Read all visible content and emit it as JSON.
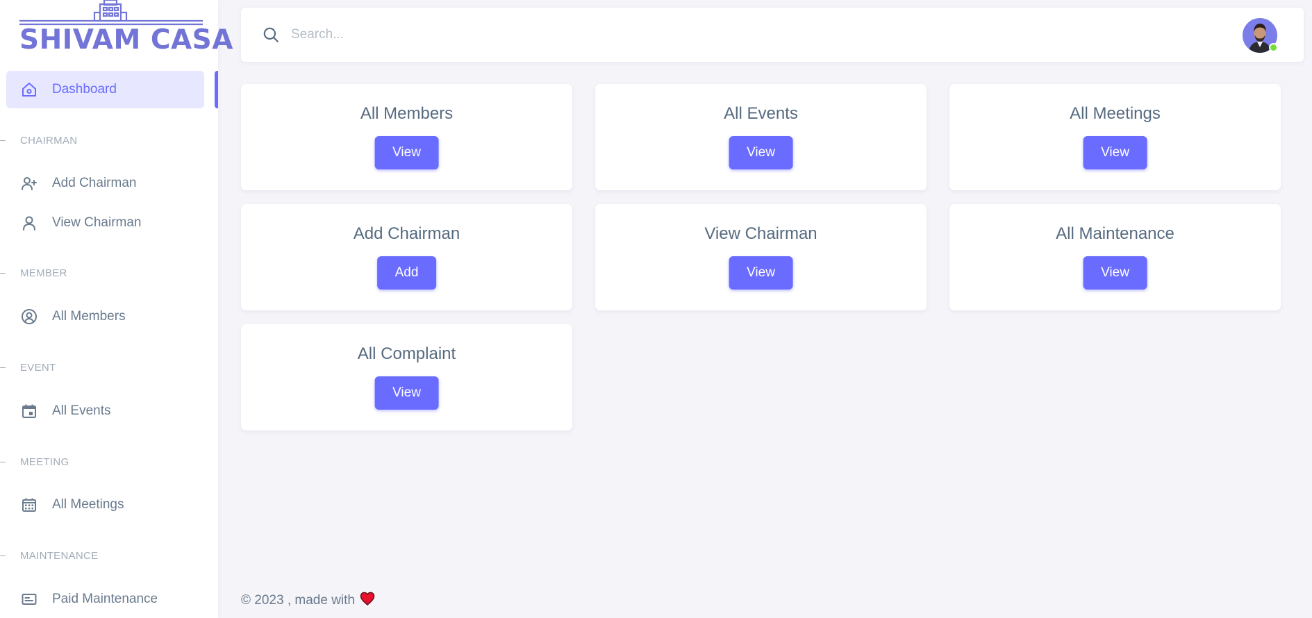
{
  "brand": {
    "name": "SHIVAM CASA",
    "color": "#7275d6"
  },
  "accent_color": "#696cff",
  "sidebar": {
    "dashboard_label": "Dashboard",
    "sections": [
      {
        "header": "CHAIRMAN",
        "items": [
          {
            "label": "Add Chairman",
            "icon": "user-plus-icon"
          },
          {
            "label": "View Chairman",
            "icon": "user-icon"
          }
        ]
      },
      {
        "header": "MEMBER",
        "items": [
          {
            "label": "All Members",
            "icon": "user-circle-icon"
          }
        ]
      },
      {
        "header": "EVENT",
        "items": [
          {
            "label": "All Events",
            "icon": "calendar-event-icon"
          }
        ]
      },
      {
        "header": "MEETING",
        "items": [
          {
            "label": "All Meetings",
            "icon": "calendar-grid-icon"
          }
        ]
      },
      {
        "header": "MAINTENANCE",
        "items": [
          {
            "label": "Paid Maintenance",
            "icon": "id-card-icon"
          }
        ]
      }
    ]
  },
  "navbar": {
    "search_placeholder": "Search...",
    "search_icon": "search-icon",
    "avatar_status": "online"
  },
  "cards": [
    {
      "title": "All Members",
      "button": "View"
    },
    {
      "title": "All Events",
      "button": "View"
    },
    {
      "title": "All Meetings",
      "button": "View"
    },
    {
      "title": "Add Chairman",
      "button": "Add"
    },
    {
      "title": "View Chairman",
      "button": "View"
    },
    {
      "title": "All Maintenance",
      "button": "View"
    },
    {
      "title": "All Complaint",
      "button": "View"
    }
  ],
  "footer": {
    "text": "© 2023 , made with",
    "icon": "heart-icon"
  }
}
